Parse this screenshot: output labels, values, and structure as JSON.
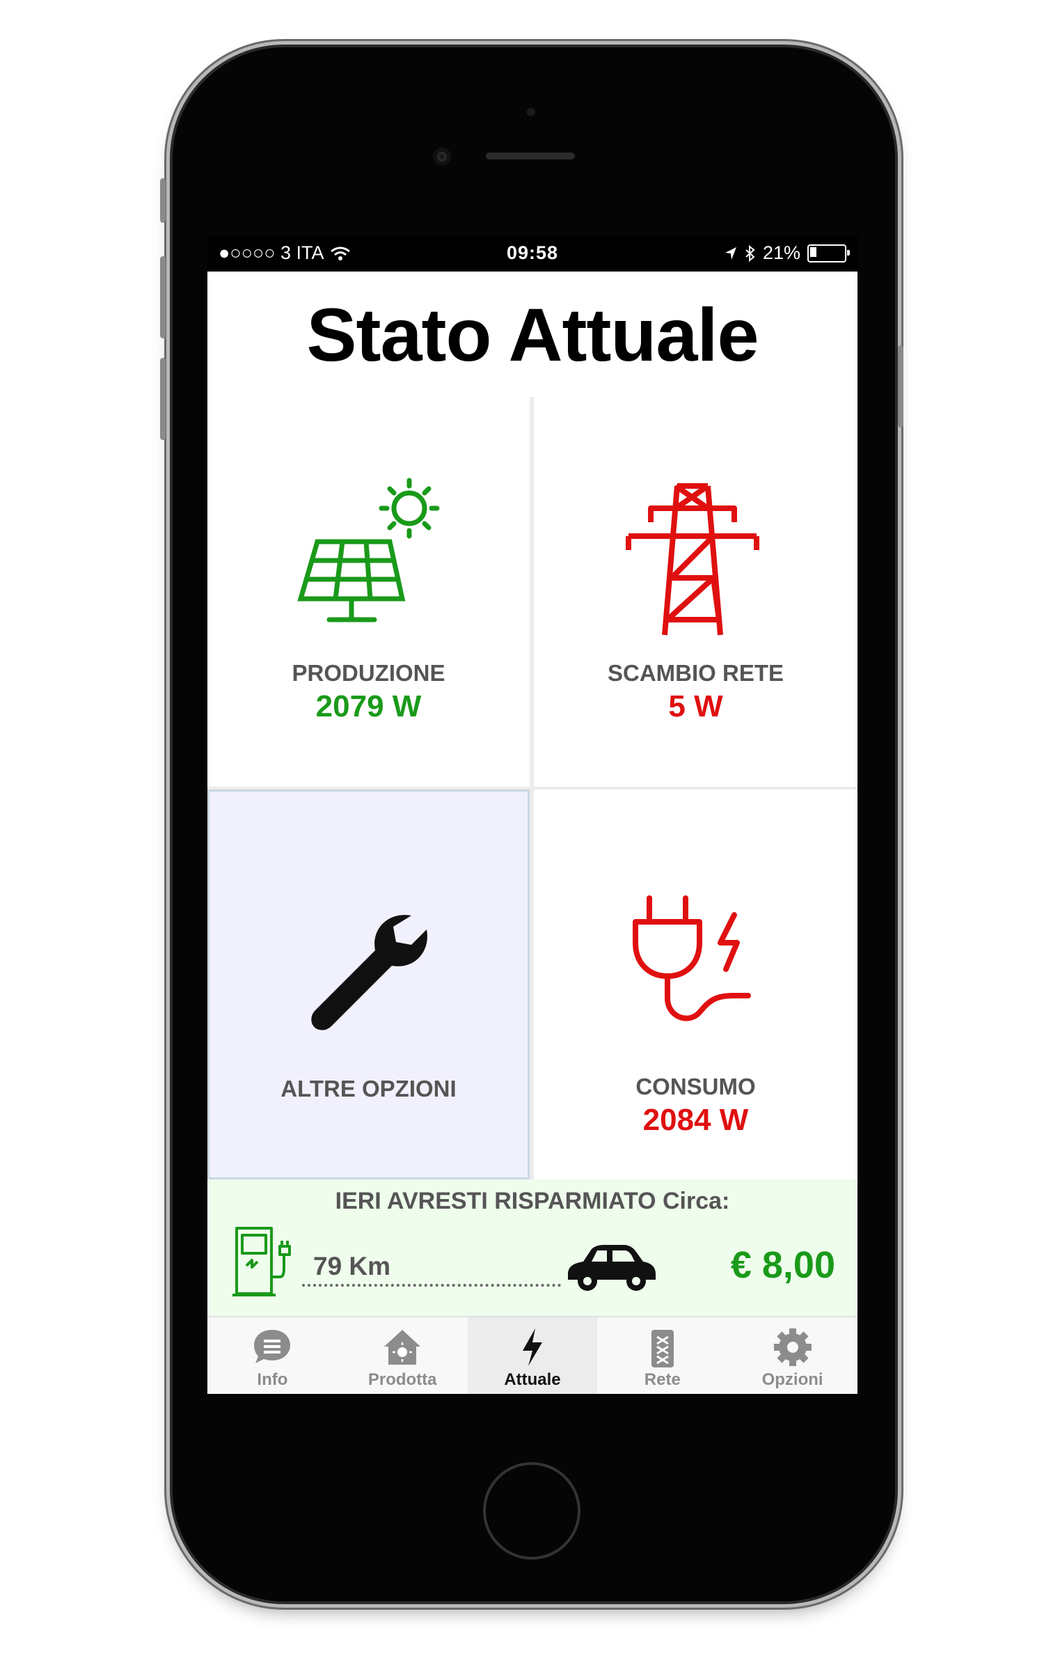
{
  "status_bar": {
    "carrier": "●○○○○ 3 ITA",
    "time": "09:58",
    "battery_percent": "21%",
    "battery_level": 0.21
  },
  "page": {
    "title": "Stato Attuale"
  },
  "tiles": {
    "production": {
      "label": "PRODUZIONE",
      "value": "2079 W",
      "color": "#1a9a1a"
    },
    "grid_exchange": {
      "label": "SCAMBIO RETE",
      "value": "5 W",
      "color": "#e01010"
    },
    "other_options": {
      "label": "ALTRE OPZIONI"
    },
    "consumption": {
      "label": "CONSUMO",
      "value": "2084 W",
      "color": "#e01010"
    }
  },
  "savings": {
    "headline": "IERI AVRESTI RISPARMIATO Circa:",
    "distance": "79 Km",
    "amount": "€ 8,00"
  },
  "tabbar": {
    "tabs": [
      {
        "label": "Info",
        "icon": "chat-bubble-icon"
      },
      {
        "label": "Prodotta",
        "icon": "house-sun-icon"
      },
      {
        "label": "Attuale",
        "icon": "lightning-icon",
        "active": true
      },
      {
        "label": "Rete",
        "icon": "grid-tower-icon"
      },
      {
        "label": "Opzioni",
        "icon": "gear-icon"
      }
    ]
  },
  "colors": {
    "green": "#1a9a1a",
    "red": "#e01010",
    "selected_tile_bg": "#f1f1fe"
  }
}
